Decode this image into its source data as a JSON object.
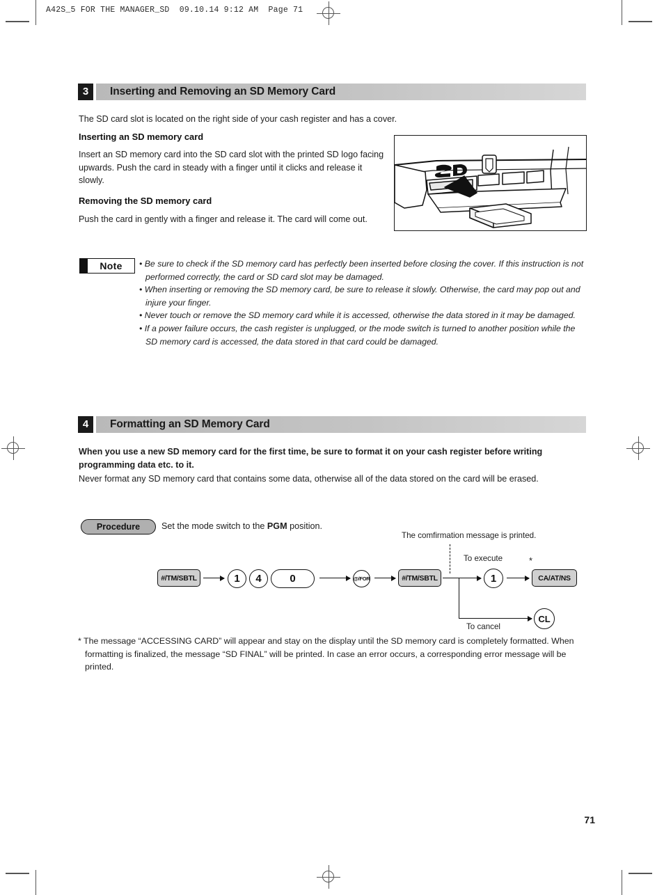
{
  "running_head": "A42S_5 FOR THE MANAGER_SD  09.10.14 9:12 AM  Page 71",
  "page_number": "71",
  "colors": {
    "section_badge": "#1a1a1a",
    "section_bar": "#c4c4c4",
    "key_fill": "#d0d0d0",
    "procedure_fill": "#b0b0b0",
    "text": "#1d1d1d"
  },
  "sections": [
    {
      "number": "3",
      "title": "Inserting and Removing an SD Memory Card",
      "intro": "The SD card slot is located on the right side of your cash register and has a cover.",
      "sub1_heading": "Inserting an SD memory card",
      "sub1_body": "Insert an SD memory card into the SD card slot with the printed SD logo facing upwards. Push the card in steady with a finger until it clicks and release it slowly.",
      "sub2_heading": "Removing the SD memory card",
      "sub2_body": "Push the card in gently with a finger and release it. The card will come out.",
      "illustration_caption": "sd-card-slot-illustration",
      "sd_logo_text": "SD"
    },
    {
      "number": "4",
      "title": "Formatting an SD Memory Card",
      "lead_bold": "When you use a new SD memory card for the first time, be sure to format it on your cash register before writing programming data etc. to it.",
      "lead_body": "Never format any SD memory card that contains some data, otherwise all of the data stored on the card will be erased."
    }
  ],
  "note": {
    "label": "Note",
    "items": [
      "Be sure to check if the SD memory card has perfectly been inserted before closing the cover. If this instruction is not performed correctly, the card or SD card slot may be damaged.",
      "When inserting or removing the SD memory card, be sure to release it slowly. Otherwise, the card may pop out and injure your finger.",
      "Never touch or remove the SD memory card while it is accessed, otherwise the data stored in it may be damaged.",
      "If a power failure occurs, the cash register is unplugged, or the mode switch is turned to another position while the SD memory card is accessed, the data stored in that card could be damaged."
    ]
  },
  "procedure": {
    "label": "Procedure",
    "instruction_before": "Set the mode switch to the ",
    "instruction_mode": "PGM",
    "instruction_after": " position.",
    "print_note": "The comfirmation message is printed.",
    "execute_label": "To execute",
    "cancel_label": "To cancel",
    "asterisk": "*",
    "keys": [
      {
        "name": "key-tm-sbtl-1",
        "label": "#/TM/SBTL",
        "shape": "rect"
      },
      {
        "name": "key-1",
        "label": "1",
        "shape": "circ"
      },
      {
        "name": "key-4",
        "label": "4",
        "shape": "circ"
      },
      {
        "name": "key-0",
        "label": "0",
        "shape": "oval"
      },
      {
        "name": "key-at-for",
        "label": "@/FOR",
        "shape": "circ"
      },
      {
        "name": "key-tm-sbtl-2",
        "label": "#/TM/SBTL",
        "shape": "rect"
      },
      {
        "name": "key-execute-1",
        "label": "1",
        "shape": "circ"
      },
      {
        "name": "key-ca-at-ns",
        "label": "CA/AT/NS",
        "shape": "rect"
      },
      {
        "name": "key-cl",
        "label": "CL",
        "shape": "circ"
      }
    ]
  },
  "footnote": "* The message “ACCESSING CARD” will appear and stay on the display until the SD memory card is completely formatted. When formatting is finalized, the message “SD FINAL” will be printed. In case an error occurs, a corresponding error message will be printed."
}
